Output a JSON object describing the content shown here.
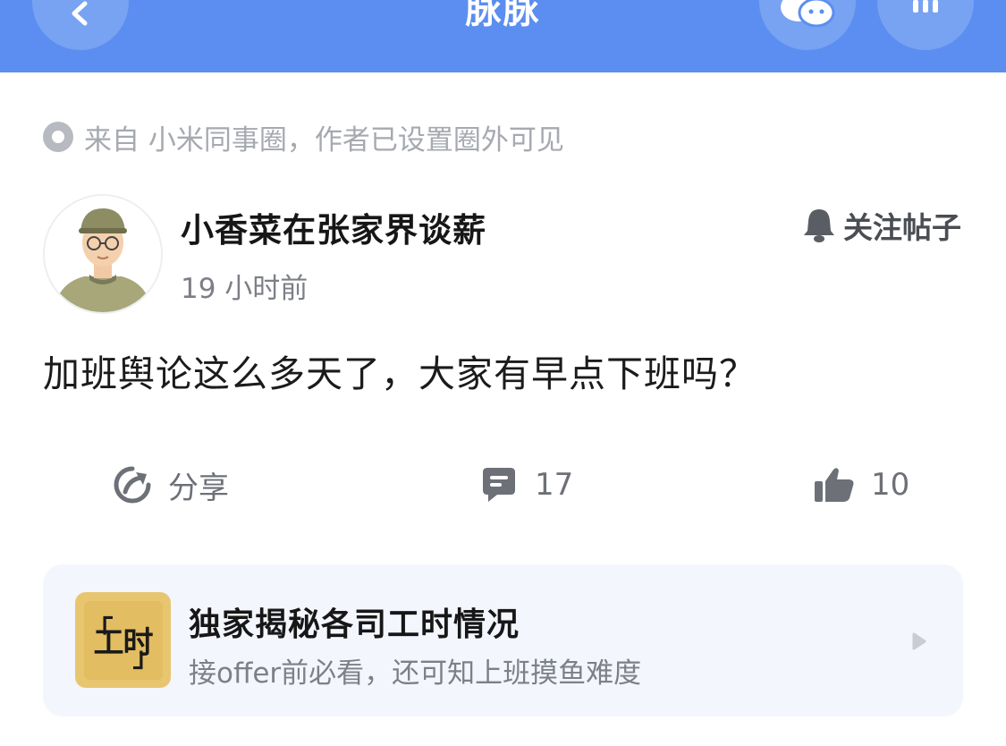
{
  "header": {
    "title": "脉脉",
    "back_icon": "chevron-left-icon",
    "wechat_icon": "wechat-icon",
    "more_icon": "more-icon",
    "background_color": "#5b8ef0"
  },
  "source": {
    "text": "来自 小米同事圈，作者已设置圈外可见"
  },
  "post": {
    "author_name": "小香菜在张家界谈薪",
    "time": "19 小时前",
    "follow_label": "关注帖子",
    "content": "加班舆论这么多天了，大家有早点下班吗？"
  },
  "actions": {
    "share_label": "分享",
    "comment_count": "17",
    "like_count": "10"
  },
  "promo": {
    "logo_text": "工时",
    "title": "独家揭秘各司工时情况",
    "subtitle": "接offer前必看，还可知上班摸鱼难度"
  }
}
